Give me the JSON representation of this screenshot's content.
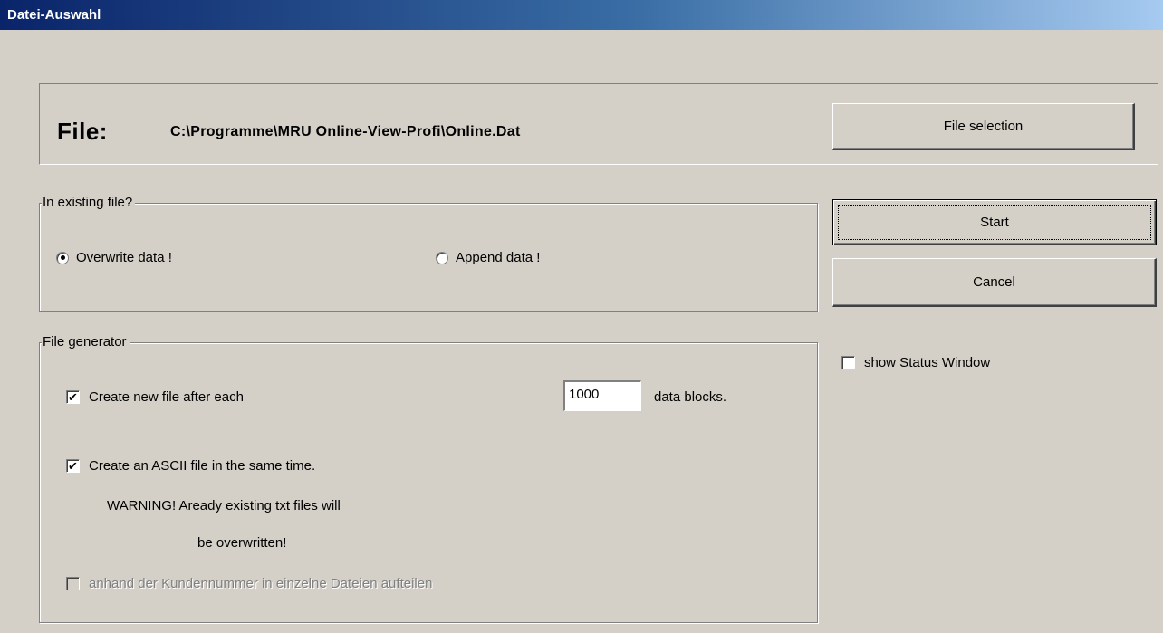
{
  "window": {
    "title": "Datei-Auswahl"
  },
  "file": {
    "label": "File:",
    "path": "C:\\Programme\\MRU Online-View-Profi\\Online.Dat",
    "selection_button": "File selection"
  },
  "buttons": {
    "start": "Start",
    "cancel": "Cancel"
  },
  "existing_group": {
    "legend": "In existing file?",
    "overwrite_label": "Overwrite data !",
    "overwrite_selected": true,
    "append_label": "Append data !",
    "append_selected": false
  },
  "status_window": {
    "label": "show Status Window",
    "checked": false
  },
  "generator_group": {
    "legend": "File generator",
    "new_file_label": "Create new file after each",
    "new_file_checked": true,
    "block_count": "1000",
    "blocks_suffix": "data blocks.",
    "ascii_label": "Create an ASCII file in the same time.",
    "ascii_checked": true,
    "warning_line1": "WARNING! Aready existing txt files will",
    "warning_line2": "be overwritten!",
    "split_label": "anhand der Kundennummer in einzelne Dateien aufteilen",
    "split_checked": false,
    "split_enabled": false
  },
  "icons": {
    "checkmark": "checkmark-icon"
  }
}
